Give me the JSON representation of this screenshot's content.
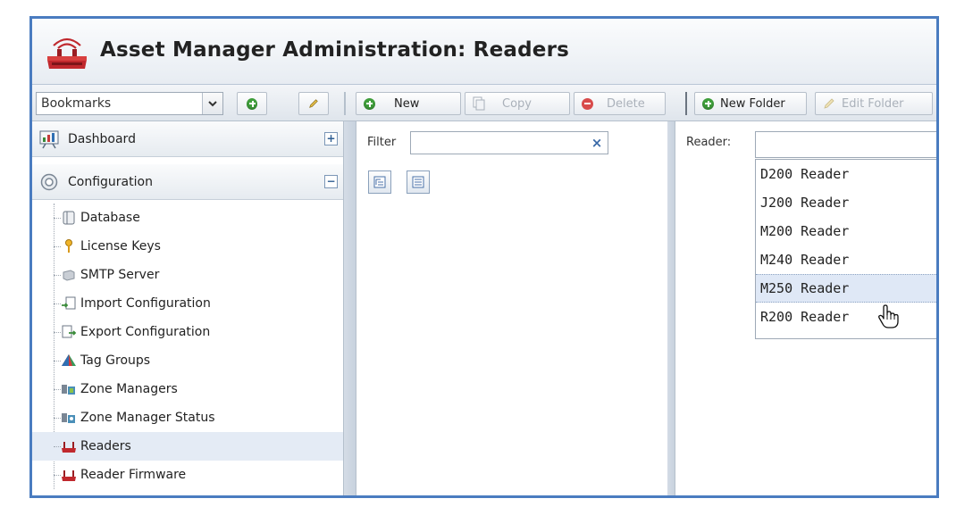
{
  "title": "Asset Manager Administration: Readers",
  "toolbar": {
    "bookmarks_value": "Bookmarks",
    "new_label": "New",
    "copy_label": "Copy",
    "delete_label": "Delete",
    "new_folder_label": "New Folder",
    "edit_folder_label": "Edit Folder"
  },
  "sidebar": {
    "sections": [
      {
        "label": "Dashboard",
        "toggle": "+",
        "icon": "dashboard-icon"
      },
      {
        "label": "Configuration",
        "toggle": "−",
        "icon": "gear-icon"
      }
    ],
    "items": [
      {
        "label": "Database",
        "icon": "database-icon"
      },
      {
        "label": "License Keys",
        "icon": "key-icon"
      },
      {
        "label": "SMTP Server",
        "icon": "server-icon"
      },
      {
        "label": "Import Configuration",
        "icon": "import-icon"
      },
      {
        "label": "Export Configuration",
        "icon": "export-icon"
      },
      {
        "label": "Tag Groups",
        "icon": "tag-group-icon"
      },
      {
        "label": "Zone Managers",
        "icon": "zone-manager-icon"
      },
      {
        "label": "Zone Manager Status",
        "icon": "zone-status-icon"
      },
      {
        "label": "Readers",
        "icon": "reader-icon",
        "selected": true
      },
      {
        "label": "Reader Firmware",
        "icon": "reader-firmware-icon"
      }
    ]
  },
  "middle": {
    "filter_label": "Filter",
    "filter_value": "",
    "clear_symbol": "×"
  },
  "right": {
    "reader_label": "Reader:",
    "reader_value": "",
    "options": [
      "D200 Reader",
      "J200 Reader",
      "M200 Reader",
      "M240 Reader",
      "M250 Reader",
      "R200 Reader"
    ],
    "hovered_option": "M250 Reader"
  },
  "colors": {
    "frame_border": "#4a7cc0",
    "add_green": "#3f9e3b",
    "delete_red": "#d84b4b",
    "reader_red": "#c0282d",
    "selected_bg": "#e4ebf5"
  }
}
